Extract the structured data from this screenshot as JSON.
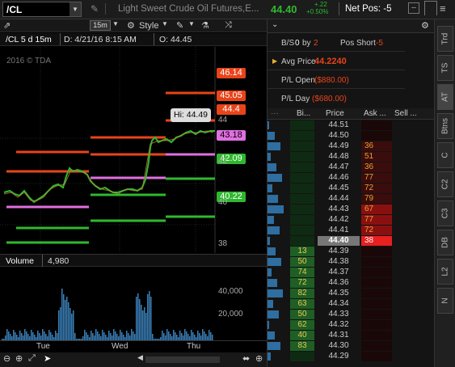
{
  "symbol": "/CL",
  "header": {
    "description": "Light Sweet Crude Oil Futures,E...",
    "last_price": "44.40",
    "change": "+.22",
    "change_pct": "+0.50%",
    "net_pos": "Net Pos: -5"
  },
  "chart_toolbar": {
    "interval": "15m",
    "style_label": "Style"
  },
  "chart_info": {
    "title": "/CL 5 d 15m",
    "date": "D: 4/21/16 8:15 AM",
    "open": "O: 44.45",
    "copyright": "2016 © TDA",
    "hi_label": "Hi: 44.49"
  },
  "price_tags": [
    {
      "label": "46.14",
      "color": "#e8441a"
    },
    {
      "label": "45.05",
      "color": "#e8441a"
    },
    {
      "label": "44.4",
      "color": "#e8441a"
    },
    {
      "label": "43.18",
      "color": "#e070e0"
    },
    {
      "label": "42.09",
      "color": "#2fb82f"
    },
    {
      "label": "40.22",
      "color": "#2fb82f"
    }
  ],
  "price_axis": [
    "44",
    "42",
    "40",
    "38"
  ],
  "volume": {
    "label": "Volume",
    "value": "4,980",
    "axis": [
      "40,000",
      "20,000"
    ]
  },
  "time_axis": [
    "Tue",
    "Wed",
    "Thu"
  ],
  "order_panel": {
    "bs_label": "B/S",
    "bs_buy": "0",
    "bs_by": "by",
    "bs_sell": "2",
    "pos_label": "Pos Short",
    "pos_value": "-5",
    "avg_label": "Avg Price",
    "avg_value": "44.2240",
    "pl_open_label": "P/L Open",
    "pl_open_value": "($880.00)",
    "pl_day_label": "P/L Day",
    "pl_day_value": "($680.00)"
  },
  "ladder_headers": {
    "buy": "Bi...",
    "price": "Price",
    "ask": "Ask ...",
    "sell": "Sell ..."
  },
  "ladder": [
    {
      "price": "44.51",
      "bid": "",
      "ask": ""
    },
    {
      "price": "44.50",
      "bid": "",
      "ask": ""
    },
    {
      "price": "44.49",
      "bid": "",
      "ask": "36"
    },
    {
      "price": "44.48",
      "bid": "",
      "ask": "51"
    },
    {
      "price": "44.47",
      "bid": "",
      "ask": "36"
    },
    {
      "price": "44.46",
      "bid": "",
      "ask": "77"
    },
    {
      "price": "44.45",
      "bid": "",
      "ask": "72"
    },
    {
      "price": "44.44",
      "bid": "",
      "ask": "79"
    },
    {
      "price": "44.43",
      "bid": "",
      "ask": "67"
    },
    {
      "price": "44.42",
      "bid": "",
      "ask": "77"
    },
    {
      "price": "44.41",
      "bid": "",
      "ask": "72"
    },
    {
      "price": "44.40",
      "bid": "",
      "ask": "38"
    },
    {
      "price": "44.39",
      "bid": "13",
      "ask": ""
    },
    {
      "price": "44.38",
      "bid": "50",
      "ask": ""
    },
    {
      "price": "44.37",
      "bid": "74",
      "ask": ""
    },
    {
      "price": "44.36",
      "bid": "72",
      "ask": ""
    },
    {
      "price": "44.35",
      "bid": "82",
      "ask": ""
    },
    {
      "price": "44.34",
      "bid": "63",
      "ask": ""
    },
    {
      "price": "44.33",
      "bid": "50",
      "ask": ""
    },
    {
      "price": "44.32",
      "bid": "62",
      "ask": ""
    },
    {
      "price": "44.31",
      "bid": "40",
      "ask": ""
    },
    {
      "price": "44.30",
      "bid": "83",
      "ask": ""
    },
    {
      "price": "44.29",
      "bid": "",
      "ask": ""
    }
  ],
  "side_tabs": [
    "Trd",
    "TS",
    "AT",
    "Btns",
    "C",
    "C2",
    "C3",
    "DB",
    "L2",
    "N"
  ],
  "colors": {
    "green": "#2fb82f",
    "red": "#e8441a",
    "pink": "#e070e0",
    "volume": "#3a7fb8"
  }
}
